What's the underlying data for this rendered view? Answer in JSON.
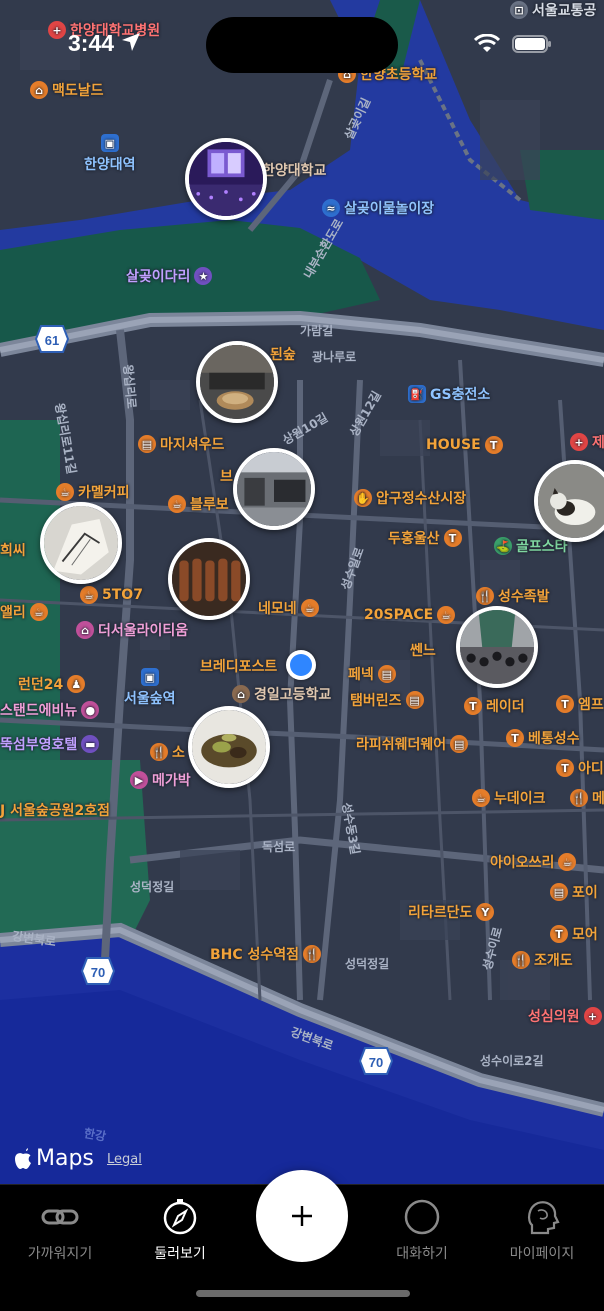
{
  "status_bar": {
    "time": "3:44"
  },
  "map": {
    "pois": [
      {
        "id": "hy-hospital",
        "label": "한양대학교병원",
        "color": "red",
        "icon": "hospital-icon"
      },
      {
        "id": "seoul-traffic",
        "label": "서울교통공",
        "color": "gray",
        "icon": "car-icon"
      },
      {
        "id": "mcdonalds",
        "label": "맥도날드",
        "color": "orange",
        "icon": "restaurant-icon"
      },
      {
        "id": "hanyang-elem",
        "label": "한양초등학교",
        "color": "orange",
        "icon": "school-icon"
      },
      {
        "id": "hanyang-univ-stn",
        "label": "한양대역",
        "color": "blue",
        "icon": "subway-icon"
      },
      {
        "id": "hanyang-univ",
        "label": "한양대학교",
        "color": "brown",
        "icon": "school-icon"
      },
      {
        "id": "salgoji-water",
        "label": "살곶이물놀이장",
        "color": "blue",
        "icon": "swim-icon"
      },
      {
        "id": "salgoji-bridge",
        "label": "살곶이다리",
        "color": "purple",
        "icon": "star-icon"
      },
      {
        "id": "seoulforest-top",
        "label": "된숲",
        "color": "orange",
        "icon": "restaurant-icon"
      },
      {
        "id": "gs-station",
        "label": "GS충전소",
        "color": "blue",
        "icon": "gas-icon"
      },
      {
        "id": "majisyeowoodeu",
        "label": "마지셔우드",
        "color": "orange",
        "icon": "bag-icon"
      },
      {
        "id": "house",
        "label": "HOUSE",
        "color": "orange",
        "icon": "shirt-icon"
      },
      {
        "id": "je",
        "label": "제",
        "color": "red",
        "icon": "hospital-icon"
      },
      {
        "id": "camel-coffee",
        "label": "카멜커피",
        "color": "orange",
        "icon": "coffee-icon"
      },
      {
        "id": "blue-bottle",
        "label": "블루보",
        "color": "orange",
        "icon": "coffee-icon"
      },
      {
        "id": "br",
        "label": "브",
        "color": "orange",
        "icon": "restaurant-icon"
      },
      {
        "id": "apgujeong-market",
        "label": "압구정수산시장",
        "color": "orange",
        "icon": "food-icon"
      },
      {
        "id": "heessi",
        "label": "희씨",
        "color": "orange",
        "icon": "coffee-icon"
      },
      {
        "id": "duheung",
        "label": "두홍울산",
        "color": "orange",
        "icon": "shirt-icon"
      },
      {
        "id": "golf",
        "label": "골프스타",
        "color": "green",
        "icon": "golf-icon"
      },
      {
        "id": "5to7",
        "label": "5TO7",
        "color": "orange",
        "icon": "coffee-icon"
      },
      {
        "id": "seongsu-jokbal",
        "label": "성수족발",
        "color": "orange",
        "icon": "restaurant-icon"
      },
      {
        "id": "aeolli",
        "label": "앨리",
        "color": "orange",
        "icon": "coffee-icon"
      },
      {
        "id": "the-seoul-lite",
        "label": "더서울라이티움",
        "color": "pink",
        "icon": "museum-icon"
      },
      {
        "id": "nemone",
        "label": "네모네",
        "color": "orange",
        "icon": "coffee-icon"
      },
      {
        "id": "20space",
        "label": "20SPACE",
        "color": "orange",
        "icon": "coffee-icon"
      },
      {
        "id": "ssendeu",
        "label": "쎈느",
        "color": "orange",
        "icon": "coffee-icon"
      },
      {
        "id": "brady",
        "label": "브레디포스트",
        "color": "orange",
        "icon": "bakery-icon"
      },
      {
        "id": "penek",
        "label": "페넥",
        "color": "orange",
        "icon": "bag-icon"
      },
      {
        "id": "london24",
        "label": "런던24",
        "color": "orange",
        "icon": "person-icon"
      },
      {
        "id": "seoulsoop-stn",
        "label": "서울숲역",
        "color": "blue",
        "icon": "subway-icon"
      },
      {
        "id": "gyeongil-hs",
        "label": "경일고등학교",
        "color": "brown",
        "icon": "school-icon"
      },
      {
        "id": "tamburins",
        "label": "탬버린즈",
        "color": "orange",
        "icon": "bag-icon"
      },
      {
        "id": "raider",
        "label": "레이더",
        "color": "orange",
        "icon": "shirt-icon"
      },
      {
        "id": "emp",
        "label": "엠프",
        "color": "orange",
        "icon": "shirt-icon"
      },
      {
        "id": "stand-ave",
        "label": "스탠드에비뉴",
        "color": "pink",
        "icon": "circle-icon"
      },
      {
        "id": "ttukseom-hotel",
        "label": "뚝섬부영호텔",
        "color": "purple",
        "icon": "bed-icon"
      },
      {
        "id": "lapis",
        "label": "라피쉬웨더웨어",
        "color": "orange",
        "icon": "bag-icon"
      },
      {
        "id": "betong",
        "label": "베통성수",
        "color": "orange",
        "icon": "shirt-icon"
      },
      {
        "id": "so",
        "label": "소",
        "color": "orange",
        "icon": "restaurant-icon"
      },
      {
        "id": "adi",
        "label": "아디",
        "color": "orange",
        "icon": "shirt-icon"
      },
      {
        "id": "megabox",
        "label": "메가박",
        "color": "pink",
        "icon": "movie-icon"
      },
      {
        "id": "seoulsoop-park2",
        "label": "J 서울숲공원2호점",
        "color": "orange",
        "icon": "none"
      },
      {
        "id": "nudake",
        "label": "누데이크",
        "color": "orange",
        "icon": "coffee-icon"
      },
      {
        "id": "m",
        "label": "메",
        "color": "orange",
        "icon": "restaurant-icon"
      },
      {
        "id": "ioshri",
        "label": "아이오쓰리",
        "color": "orange",
        "icon": "coffee-icon"
      },
      {
        "id": "poi",
        "label": "포이",
        "color": "orange",
        "icon": "bag-icon"
      },
      {
        "id": "retardando",
        "label": "리타르단도",
        "color": "orange",
        "icon": "bar-icon"
      },
      {
        "id": "moeo",
        "label": "모어",
        "color": "orange",
        "icon": "shirt-icon"
      },
      {
        "id": "bhc",
        "label": "BHC 성수역점",
        "color": "orange",
        "icon": "restaurant-icon"
      },
      {
        "id": "jogaedo",
        "label": "조개도",
        "color": "orange",
        "icon": "restaurant-icon"
      },
      {
        "id": "seongsim",
        "label": "성심의원",
        "color": "red",
        "icon": "hospital-icon"
      }
    ],
    "roads": [
      "가람길",
      "광나루로",
      "성수이로",
      "왕십리로",
      "독섬로",
      "성덕정길",
      "강변북로",
      "성덕정길",
      "성수일로",
      "성수이로2길",
      "상원12길",
      "상원10길",
      "내부순환도로",
      "살곶이길",
      "한강",
      "성수동3길",
      "왕십리로11길"
    ],
    "route_shields": [
      "61",
      "70",
      "70"
    ],
    "attribution": {
      "brand": "Maps",
      "legal": "Legal"
    }
  },
  "fab": {
    "icon": "plus-icon"
  },
  "tabs": [
    {
      "label": "가까워지기",
      "icon": "link-icon",
      "active": false
    },
    {
      "label": "둘러보기",
      "icon": "compass-icon",
      "active": true
    },
    {
      "label": "대화하기",
      "icon": "chat-circle-icon",
      "active": false
    },
    {
      "label": "마이페이지",
      "icon": "head-profile-icon",
      "active": false
    }
  ]
}
